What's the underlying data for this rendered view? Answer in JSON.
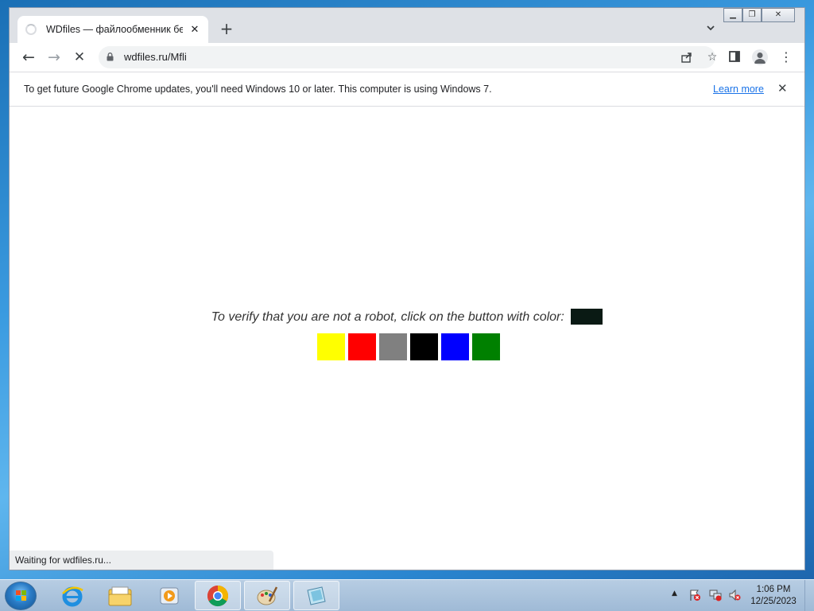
{
  "browser": {
    "tab": {
      "title": "WDfiles — файлообменник бесплатно",
      "close_label": "✕"
    },
    "newtab_label": "+",
    "tabsearch_label": "⌄",
    "caption": {
      "minimize": "▁",
      "restore": "❐",
      "close": "✕"
    },
    "toolbar": {
      "back": "←",
      "forward": "→",
      "stop": "✕",
      "url": "wdfiles.ru/Mfli"
    },
    "infobar": {
      "message": "To get future Google Chrome updates, you'll need Windows 10 or later. This computer is using Windows 7.",
      "learn_more": "Learn more",
      "close": "✕"
    },
    "status_text": "Waiting for wdfiles.ru..."
  },
  "page": {
    "captcha_prompt": "To verify that you are not a robot, click on the button with color:",
    "target_color": "#0a1a14",
    "swatches": [
      {
        "color": "#ffff00"
      },
      {
        "color": "#ff0000"
      },
      {
        "color": "#808080"
      },
      {
        "color": "#000000"
      },
      {
        "color": "#0000ff"
      },
      {
        "color": "#008000"
      }
    ]
  },
  "taskbar": {
    "items": [
      "internet-explorer-icon",
      "windows-explorer-icon",
      "media-player-icon",
      "chrome-icon",
      "paint-icon",
      "app-icon"
    ],
    "clock_time": "1:06 PM",
    "clock_date": "12/25/2023"
  }
}
